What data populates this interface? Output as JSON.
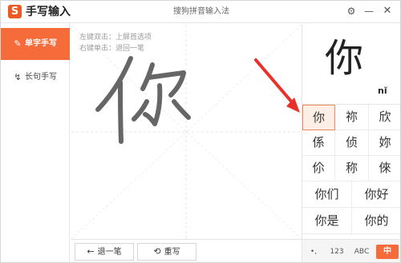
{
  "titlebar": {
    "logo_glyph": "S",
    "app_name": "手写输入",
    "window_title": "搜狗拼音输入法",
    "settings_icon": "gear-icon",
    "minimize_icon": "minimize-icon",
    "close_icon": "close-icon",
    "settings_glyph": "⚙",
    "minimize_glyph": "—",
    "close_glyph": "✕"
  },
  "sidebar": {
    "items": [
      {
        "label": "单字手写",
        "icon": "edit-icon",
        "glyph": "✎",
        "active": true
      },
      {
        "label": "长句手写",
        "icon": "handwriting-icon",
        "glyph": "↯",
        "active": false
      }
    ]
  },
  "pad": {
    "hint_line1": "左键双击：上屏首选项",
    "hint_line2": "右键单击：退回一笔",
    "undo_label": "退一笔",
    "undo_glyph": "←",
    "rewrite_label": "重写",
    "rewrite_glyph": "⟲"
  },
  "candidates": {
    "preview_char": "你",
    "preview_pinyin": "nǐ",
    "single": [
      "你",
      "祢",
      "欣",
      "係",
      "侦",
      "妳",
      "伱",
      "称",
      "倈"
    ],
    "words": [
      "你们",
      "你好",
      "你是",
      "你的"
    ],
    "selected_index": 0
  },
  "keyboard": {
    "punc": "•,",
    "num": "123",
    "abc": "ABC",
    "zh": "中"
  },
  "colors": {
    "accent": "#f56b3a",
    "selected_bg": "#fdeee6",
    "annotation_arrow": "#e8312a"
  }
}
